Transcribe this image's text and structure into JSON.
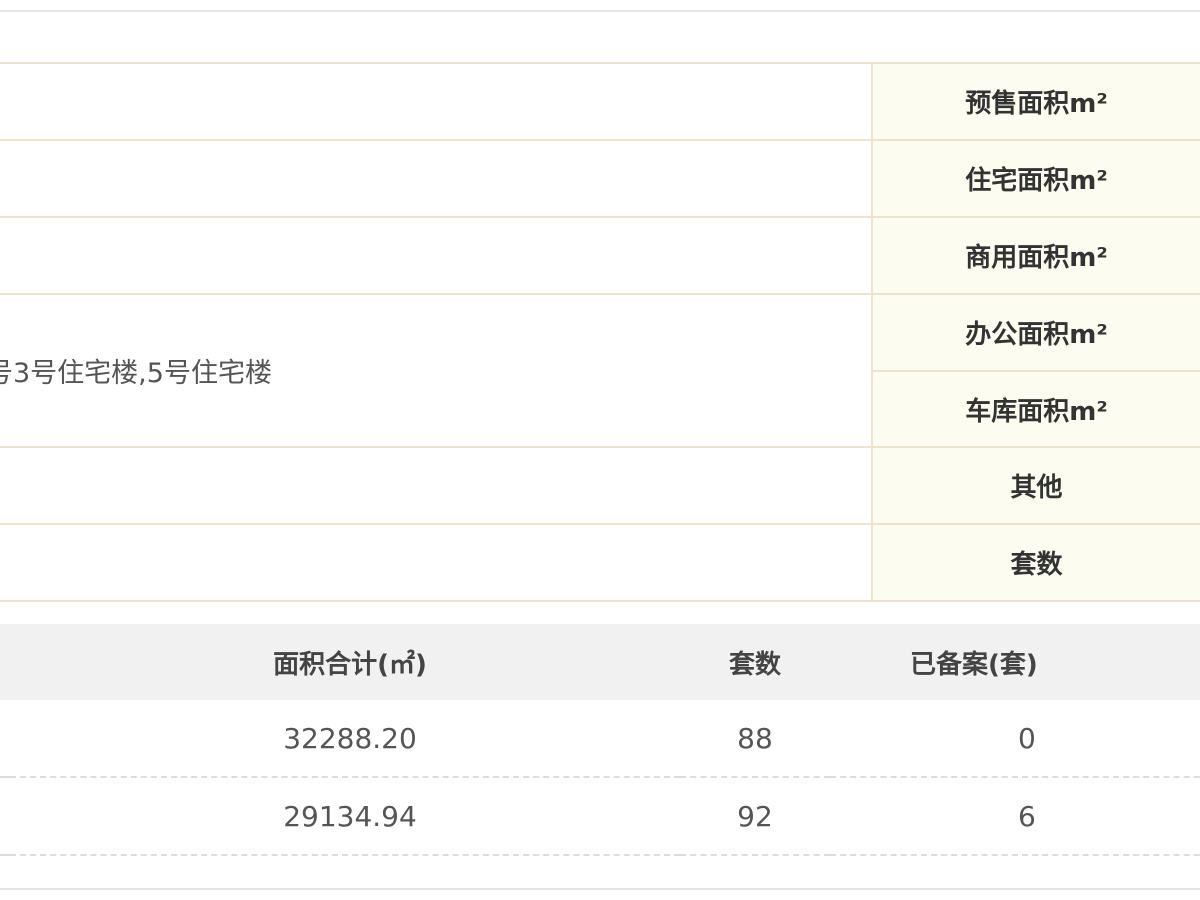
{
  "info_rows": [
    {
      "value": "",
      "label": "预售面积m²"
    },
    {
      "value": "",
      "label": "住宅面积m²"
    },
    {
      "value": "",
      "label": "商用面积m²"
    },
    {
      "value": "号3号住宅楼,5号住宅楼",
      "label": "办公面积m²"
    },
    {
      "value": "",
      "label": "车库面积m²"
    },
    {
      "value": "",
      "label": "其他"
    },
    {
      "value": "",
      "label": "套数"
    }
  ],
  "records": {
    "headers": [
      "面积合计(㎡)",
      "套数",
      "已备案(套)"
    ],
    "rows": [
      {
        "area": "32288.20",
        "units": "88",
        "filed": "0"
      },
      {
        "area": "29134.94",
        "units": "92",
        "filed": "6"
      }
    ]
  }
}
